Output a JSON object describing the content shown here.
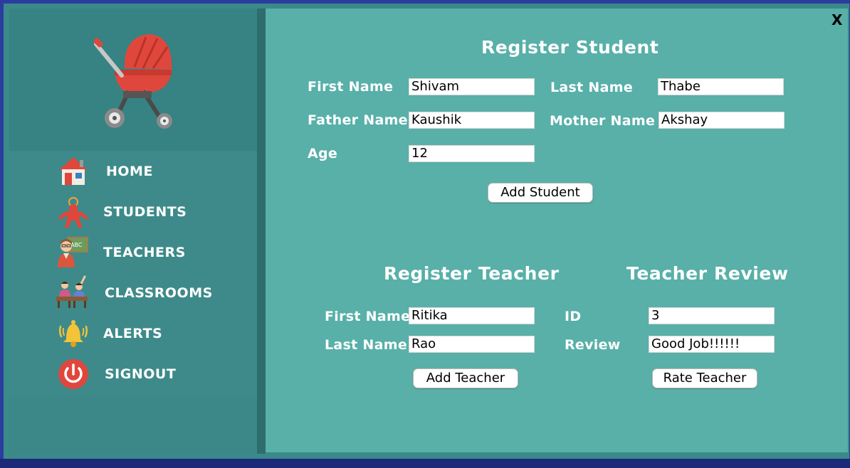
{
  "window": {
    "close_label": "X"
  },
  "sidebar": {
    "logo": "stroller-icon",
    "items": [
      {
        "label": "HOME",
        "icon": "house-icon"
      },
      {
        "label": "STUDENTS",
        "icon": "child-icon"
      },
      {
        "label": "TEACHERS",
        "icon": "teacher-icon"
      },
      {
        "label": "CLASSROOMS",
        "icon": "classroom-icon"
      },
      {
        "label": "ALERTS",
        "icon": "bell-icon"
      },
      {
        "label": "SIGNOUT",
        "icon": "power-icon"
      }
    ]
  },
  "register_student": {
    "title": "Register Student",
    "first_name_label": "First Name",
    "first_name_value": "Shivam",
    "last_name_label": "Last Name",
    "last_name_value": "Thabe",
    "father_name_label": "Father Name",
    "father_name_value": "Kaushik",
    "mother_name_label": "Mother Name",
    "mother_name_value": "Akshay",
    "age_label": "Age",
    "age_value": "12",
    "add_button": "Add Student"
  },
  "register_teacher": {
    "title": "Register Teacher",
    "first_name_label": "First Name",
    "first_name_value": "Ritika",
    "last_name_label": "Last Name",
    "last_name_value": "Rao",
    "add_button": "Add Teacher"
  },
  "teacher_review": {
    "title": "Teacher Review",
    "id_label": "ID",
    "id_value": "3",
    "review_label": "Review",
    "review_value": "Good Job!!!!!!",
    "rate_button": "Rate Teacher"
  },
  "colors": {
    "main_bg": "#58b0a8",
    "sidebar_bg": "#3c8787",
    "accent_red": "#e0473c"
  }
}
